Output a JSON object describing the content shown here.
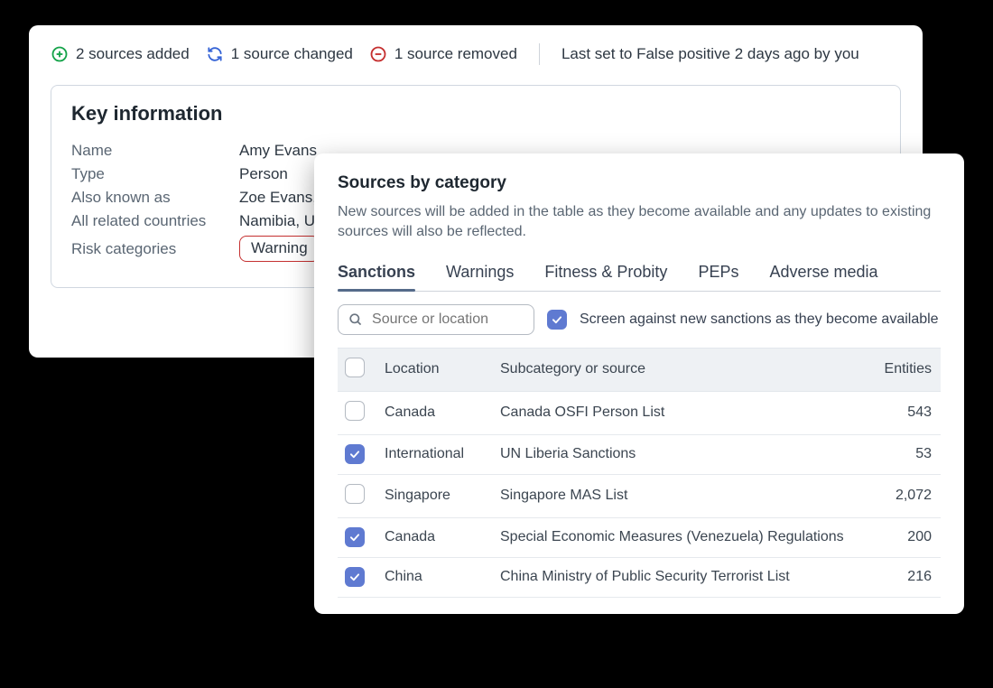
{
  "status": {
    "added": "2 sources added",
    "changed": "1 source changed",
    "removed": "1 source removed",
    "last_action": "Last set to False positive 2 days ago by you"
  },
  "key_info": {
    "title": "Key information",
    "rows": {
      "name_label": "Name",
      "name_value": "Amy Evans",
      "type_label": "Type",
      "type_value": "Person",
      "aka_label": "Also known as",
      "aka_value": "Zoe Evans,",
      "countries_label": "All related countries",
      "countries_value": "Namibia, U",
      "risk_label": "Risk categories",
      "risk_value": "Warning"
    }
  },
  "sources_panel": {
    "title": "Sources by category",
    "description": "New sources will be added in the table as they become available and any updates to existing sources will also be reflected.",
    "tabs": [
      "Sanctions",
      "Warnings",
      "Fitness & Probity",
      "PEPs",
      "Adverse media"
    ],
    "active_tab_index": 0,
    "search_placeholder": "Source or location",
    "screen_checkbox_label": "Screen against new sanctions as they become available",
    "table_headers": {
      "col1": "Location",
      "col2": "Subcategory or source",
      "col3": "Entities"
    },
    "rows": [
      {
        "checked": false,
        "location": "Canada",
        "source": "Canada OSFI Person List",
        "entities": "543"
      },
      {
        "checked": true,
        "location": "International",
        "source": "UN Liberia Sanctions",
        "entities": "53"
      },
      {
        "checked": false,
        "location": "Singapore",
        "source": "Singapore MAS List",
        "entities": "2,072"
      },
      {
        "checked": true,
        "location": "Canada",
        "source": "Special Economic Measures (Venezuela) Regulations",
        "entities": "200"
      },
      {
        "checked": true,
        "location": "China",
        "source": "China Ministry of Public Security Terrorist List",
        "entities": "216"
      }
    ]
  }
}
